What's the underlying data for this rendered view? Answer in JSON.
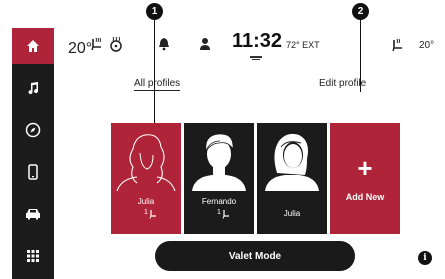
{
  "callouts": {
    "one": "1",
    "two": "2"
  },
  "status_bar": {
    "left_temp": "20°",
    "clock": "11:32",
    "ext_temp": "72° EXT",
    "right_temp": "20°"
  },
  "tabs": [
    {
      "label": "All profiles",
      "active": true
    },
    {
      "label": "Edit profile",
      "active": false
    }
  ],
  "profiles": [
    {
      "name": "Julia",
      "seat": "1",
      "selected": true
    },
    {
      "name": "Fernando",
      "seat": "1",
      "selected": false
    },
    {
      "name": "Julia",
      "seat": "",
      "selected": false
    }
  ],
  "add_new": {
    "symbol": "+",
    "label": "Add New"
  },
  "valet": {
    "label": "Valet Mode"
  },
  "info": {
    "symbol": "i"
  },
  "sidebar": {
    "items": [
      {
        "icon": "home-icon",
        "active": true
      },
      {
        "icon": "music-note-icon",
        "active": false
      },
      {
        "icon": "compass-icon",
        "active": false
      },
      {
        "icon": "phone-icon",
        "active": false
      },
      {
        "icon": "car-icon",
        "active": false
      },
      {
        "icon": "apps-grid-icon",
        "active": false
      }
    ]
  },
  "colors": {
    "accent": "#b02439",
    "dark": "#1b1b1b",
    "sidebar": "#1c1c1c"
  }
}
